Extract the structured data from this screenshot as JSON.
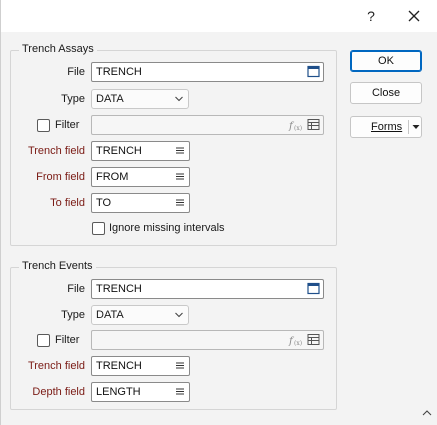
{
  "titlebar": {
    "help": "?",
    "close_icon": "close-icon"
  },
  "assays": {
    "legend": "Trench Assays",
    "file_label": "File",
    "file_value": "TRENCH",
    "type_label": "Type",
    "type_value": "DATA",
    "filter_label": "Filter",
    "filter_checked": false,
    "filter_value": "",
    "trench_label": "Trench field",
    "trench_value": "TRENCH",
    "from_label": "From field",
    "from_value": "FROM",
    "to_label": "To field",
    "to_value": "TO",
    "ignore_label": "Ignore missing intervals",
    "ignore_checked": false
  },
  "events": {
    "legend": "Trench Events",
    "file_label": "File",
    "file_value": "TRENCH",
    "type_label": "Type",
    "type_value": "DATA",
    "filter_label": "Filter",
    "filter_checked": false,
    "filter_value": "",
    "trench_label": "Trench field",
    "trench_value": "TRENCH",
    "depth_label": "Depth field",
    "depth_value": "LENGTH"
  },
  "buttons": {
    "ok": "OK",
    "close": "Close",
    "forms": "Forms"
  },
  "colors": {
    "required_label": "#7a1a14",
    "accent": "#0067c0"
  }
}
